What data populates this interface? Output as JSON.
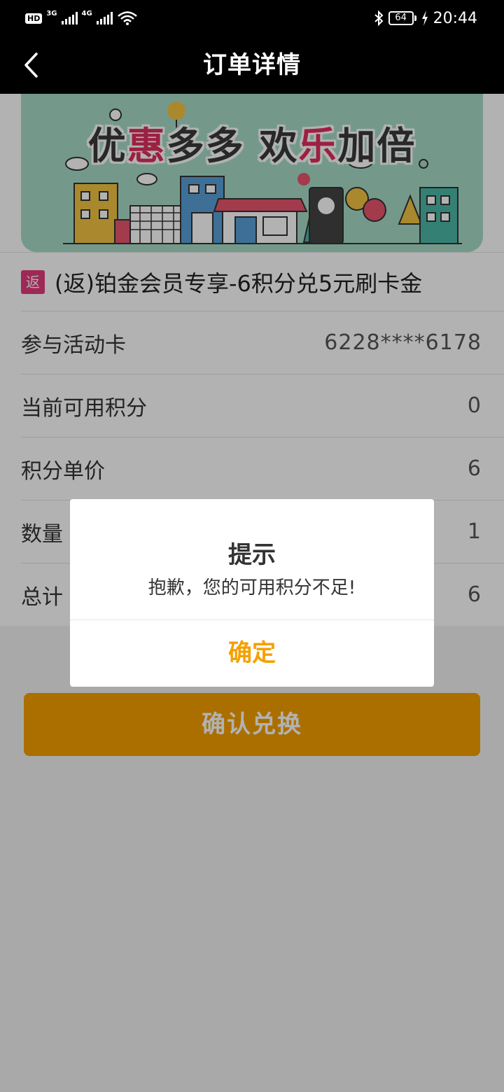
{
  "status_bar": {
    "hd_label": "HD",
    "sim1_network": "3G",
    "sim2_network": "4G",
    "battery": "64",
    "time": "20:44"
  },
  "header": {
    "title": "订单详情"
  },
  "banner": {
    "title_parts": [
      "优",
      "惠",
      "多多 欢",
      "乐",
      "加倍"
    ],
    "colors": {
      "background": "#a7dcc7",
      "highlight": "#e02f5d"
    }
  },
  "product": {
    "tag": "返",
    "name": "(返)铂金会员专享-6积分兑5元刷卡金"
  },
  "details": [
    {
      "label": "参与活动卡",
      "value": "6228****6178"
    },
    {
      "label": "当前可用积分",
      "value": "0"
    },
    {
      "label": "积分单价",
      "value": "6"
    },
    {
      "label": "数量",
      "value": "1"
    },
    {
      "label": "总计",
      "value": "6"
    }
  ],
  "confirm_button": {
    "label": "确认兑换"
  },
  "dialog": {
    "title": "提示",
    "message": "抱歉，您的可用积分不足!",
    "ok_label": "确定"
  },
  "colors": {
    "accent": "#f5a000",
    "tag": "#e23a7b"
  }
}
